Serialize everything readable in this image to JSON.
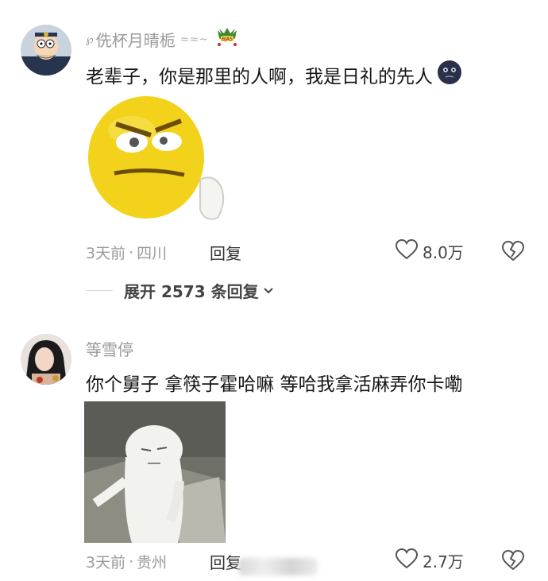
{
  "comments": [
    {
      "username": "侁杯月晴栀",
      "username_prefix_icon": "swirl-icon",
      "username_tail": "≈≈~",
      "badge_icon": "dragon-badge-icon",
      "badge_text": "BJAS",
      "text": "老辈子，你是那里的人啊，我是日礼的先人",
      "inline_emoji": "dark-moon-face-emoji",
      "image": "yellow-smiley-meme",
      "time": "3天前",
      "location": "四川",
      "reply_label": "回复",
      "like_count": "8.0万"
    },
    {
      "username": "等雪停",
      "text": "你个舅子 拿筷子霍哈嘛 等哈我拿活麻弄你卡嘞",
      "image": "white-creature-meme",
      "time": "3天前",
      "location": "贵州",
      "reply_label": "回复",
      "like_count": "2.7万"
    }
  ],
  "expand_replies": {
    "label": "展开 2573 条回复"
  },
  "colors": {
    "meta_gray": "#9a9a9a",
    "text": "#161616",
    "emoji_yellow": "#f2d21b"
  }
}
